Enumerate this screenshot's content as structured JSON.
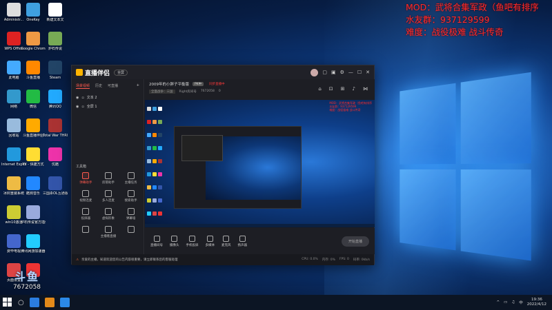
{
  "overlay": {
    "line1": "MOD：武将合集军政（鱼吧有排序",
    "line2": "水友群：937129599",
    "line3": "难度：战役极难 战斗传奇"
  },
  "desktop_icons": [
    {
      "label": "Administr...",
      "color": "#ddd"
    },
    {
      "label": "OneKey",
      "color": "#3fa0e0"
    },
    {
      "label": "新建文本文",
      "color": "#fff"
    },
    {
      "label": "WPS Office",
      "color": "#d22"
    },
    {
      "label": "Google Chrome",
      "color": "#e94"
    },
    {
      "label": "炉石传说",
      "color": "#7a5"
    },
    {
      "label": "此电脑",
      "color": "#4af"
    },
    {
      "label": "斗鱼直播",
      "color": "#f80"
    },
    {
      "label": "Steam",
      "color": "#246"
    },
    {
      "label": "网络",
      "color": "#39c"
    },
    {
      "label": "微信",
      "color": "#2b4"
    },
    {
      "label": "腾讯QQ",
      "color": "#2af"
    },
    {
      "label": "回收站",
      "color": "#9bd"
    },
    {
      "label": "斗鱼直播伴侣",
      "color": "#fa0"
    },
    {
      "label": "Total War THREE KI...",
      "color": "#a33"
    },
    {
      "label": "Internet Explorer",
      "color": "#29d"
    },
    {
      "label": "YY - 快捷方式",
      "color": "#fd3"
    },
    {
      "label": "优酷",
      "color": "#e3a"
    },
    {
      "label": "冰封重装系统",
      "color": "#eb4"
    },
    {
      "label": "酷狗音乐",
      "color": "#28f"
    },
    {
      "label": "三国杀OL互通版",
      "color": "#35a"
    },
    {
      "label": "win10激活",
      "color": "#cc3"
    },
    {
      "label": "炉石传说官方插件",
      "color": "#9ad"
    },
    {
      "label": "",
      "color": ""
    },
    {
      "label": "费毕电视",
      "color": "#46c"
    },
    {
      "label": "腾讯网游加速器",
      "color": "#2cf"
    },
    {
      "label": "",
      "color": ""
    },
    {
      "label": "页面设置",
      "color": "#d44"
    },
    {
      "label": "ES",
      "color": "#e33"
    }
  ],
  "app": {
    "brand": "直播伴侣",
    "version_badge": "全屏",
    "side_tabs": [
      "场景视频",
      "历史",
      "可直播"
    ],
    "add_label": "+",
    "scenes": [
      "文本 2",
      "全屏 1"
    ],
    "tools_title": "工具箱",
    "tools": [
      "弹幕助手",
      "房管助手",
      "主播任务",
      "视频连麦",
      "多人连麦",
      "搜索助手",
      "投屏器",
      "虚拟形象",
      "弹幕墙",
      "",
      "主播看直播",
      ""
    ],
    "stream_title": "2009年的小胖子平衡版",
    "tag_hot": "PK中",
    "tag_red": "同步直播中",
    "category": "全面战争：三国",
    "room_label": "Right房间号",
    "room_no": "7672058",
    "fans": "0",
    "bottom_tools": [
      "直播间号",
      "摄像头",
      "手机投屏",
      "多媒体",
      "麦克风",
      "扬声器"
    ],
    "go_live": "开始直播",
    "status_warn": "⚠",
    "status_text": "亲爱的主播，知道欢迎您的公告内容很重要，请立即联系您的客服处理",
    "status_right": [
      "CPU: 0.0%",
      "内存: 0%",
      "FPS: 0",
      "码率: 0kb/s"
    ]
  },
  "watermark": {
    "line1": "斗鱼",
    "line2": "7672058"
  },
  "taskbar": {
    "time": "19:36",
    "date": "2022/4/12"
  }
}
